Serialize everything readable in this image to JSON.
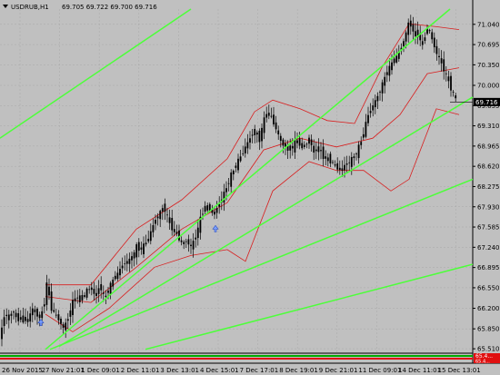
{
  "header": {
    "symbol": "USDRUB,H1",
    "ohlc": "69.705 69.722 69.700 69.716"
  },
  "colors": {
    "background": "#c0c0c0",
    "grid": "#a8a8a8",
    "candle": "#000000",
    "trendline": "#4dff3a",
    "bands": "#d81e1e",
    "current_price_bg": "#000000",
    "label_red": "#e01010",
    "label_green": "#00aa00"
  },
  "icons": {
    "arrow": "arrow-up-icon",
    "dropdown": "triangle-down-icon"
  },
  "chart_data": {
    "type": "candlestick",
    "y_ticks": [
      "71.040",
      "70.695",
      "70.350",
      "70.000",
      "69.655",
      "69.310",
      "68.965",
      "68.620",
      "68.275",
      "67.930",
      "67.585",
      "67.240",
      "66.895",
      "66.550",
      "66.200",
      "65.850",
      "65.510"
    ],
    "ylim": [
      65.45,
      71.3
    ],
    "x_ticks": [
      "26 Nov 2015",
      "27 Nov 21:01",
      "1 Dec 09:01",
      "2 Dec 11:01",
      "3 Dec 13:01",
      "4 Dec 15:01",
      "7 Dec 17:01",
      "8 Dec 19:01",
      "9 Dec 21:01",
      "11 Dec 09:01",
      "14 Dec 11:01",
      "15 Dec 13:01"
    ],
    "current_price": "69.716",
    "bottom_labels": [
      "65.4...",
      "65.4..."
    ],
    "close_path": [
      [
        0,
        65.7
      ],
      [
        5,
        66.1
      ],
      [
        10,
        66.05
      ],
      [
        15,
        66.15
      ],
      [
        20,
        66.0
      ],
      [
        25,
        66.05
      ],
      [
        30,
        65.95
      ],
      [
        35,
        66.2
      ],
      [
        40,
        66.1
      ],
      [
        45,
        66.05
      ],
      [
        50,
        66.4
      ],
      [
        52,
        66.7
      ],
      [
        55,
        66.25
      ],
      [
        60,
        66.1
      ],
      [
        65,
        66.0
      ],
      [
        70,
        65.85
      ],
      [
        75,
        66.05
      ],
      [
        80,
        66.3
      ],
      [
        85,
        66.4
      ],
      [
        90,
        66.35
      ],
      [
        95,
        66.5
      ],
      [
        100,
        66.55
      ],
      [
        105,
        66.4
      ],
      [
        110,
        66.6
      ],
      [
        115,
        66.35
      ],
      [
        120,
        66.55
      ],
      [
        125,
        66.7
      ],
      [
        130,
        66.8
      ],
      [
        135,
        66.95
      ],
      [
        140,
        67.0
      ],
      [
        145,
        67.05
      ],
      [
        150,
        67.25
      ],
      [
        155,
        67.2
      ],
      [
        160,
        67.3
      ],
      [
        165,
        67.45
      ],
      [
        170,
        67.7
      ],
      [
        175,
        67.8
      ],
      [
        180,
        67.95
      ],
      [
        185,
        67.7
      ],
      [
        190,
        67.55
      ],
      [
        195,
        67.45
      ],
      [
        200,
        67.3
      ],
      [
        205,
        67.35
      ],
      [
        210,
        67.25
      ],
      [
        215,
        67.4
      ],
      [
        220,
        67.7
      ],
      [
        225,
        67.95
      ],
      [
        230,
        67.9
      ],
      [
        235,
        67.8
      ],
      [
        240,
        67.95
      ],
      [
        245,
        68.1
      ],
      [
        250,
        68.3
      ],
      [
        255,
        68.5
      ],
      [
        260,
        68.65
      ],
      [
        265,
        68.8
      ],
      [
        270,
        68.95
      ],
      [
        275,
        69.1
      ],
      [
        280,
        69.25
      ],
      [
        285,
        69.05
      ],
      [
        290,
        69.4
      ],
      [
        295,
        69.55
      ],
      [
        300,
        69.4
      ],
      [
        305,
        69.2
      ],
      [
        310,
        69.0
      ],
      [
        315,
        68.95
      ],
      [
        320,
        68.9
      ],
      [
        325,
        69.05
      ],
      [
        330,
        69.0
      ],
      [
        335,
        68.95
      ],
      [
        340,
        69.1
      ],
      [
        345,
        68.85
      ],
      [
        350,
        68.95
      ],
      [
        355,
        68.8
      ],
      [
        360,
        68.75
      ],
      [
        365,
        68.7
      ],
      [
        370,
        68.6
      ],
      [
        375,
        68.55
      ],
      [
        380,
        68.65
      ],
      [
        385,
        68.7
      ],
      [
        390,
        68.8
      ],
      [
        395,
        68.95
      ],
      [
        400,
        69.2
      ],
      [
        405,
        69.5
      ],
      [
        410,
        69.65
      ],
      [
        415,
        69.8
      ],
      [
        420,
        70.0
      ],
      [
        425,
        70.2
      ],
      [
        430,
        70.35
      ],
      [
        435,
        70.45
      ],
      [
        440,
        70.6
      ],
      [
        445,
        70.8
      ],
      [
        450,
        71.1
      ],
      [
        455,
        70.9
      ],
      [
        460,
        70.85
      ],
      [
        465,
        70.7
      ],
      [
        470,
        71.0
      ],
      [
        475,
        70.8
      ],
      [
        480,
        70.55
      ],
      [
        485,
        70.4
      ],
      [
        490,
        70.2
      ],
      [
        495,
        70.0
      ],
      [
        500,
        69.8
      ],
      [
        503,
        69.716
      ]
    ],
    "trendlines": [
      {
        "from": [
          0,
          69.1
        ],
        "to": [
          210,
          71.3
        ]
      },
      {
        "from": [
          50,
          65.5
        ],
        "to": [
          495,
          71.3
        ]
      },
      {
        "from": [
          65,
          65.55
        ],
        "to": [
          520,
          69.8
        ]
      },
      {
        "from": [
          55,
          65.5
        ],
        "to": [
          520,
          68.4
        ]
      },
      {
        "from": [
          160,
          65.5
        ],
        "to": [
          520,
          66.95
        ]
      }
    ],
    "band_upper": [
      [
        50,
        66.6
      ],
      [
        100,
        66.6
      ],
      [
        150,
        67.55
      ],
      [
        200,
        68.05
      ],
      [
        250,
        68.75
      ],
      [
        280,
        69.55
      ],
      [
        300,
        69.75
      ],
      [
        330,
        69.6
      ],
      [
        360,
        69.4
      ],
      [
        390,
        69.35
      ],
      [
        420,
        70.3
      ],
      [
        450,
        71.05
      ],
      [
        480,
        71.0
      ],
      [
        505,
        70.95
      ]
    ],
    "band_lower": [
      [
        50,
        66.1
      ],
      [
        80,
        65.8
      ],
      [
        120,
        66.2
      ],
      [
        170,
        66.9
      ],
      [
        210,
        67.1
      ],
      [
        250,
        67.2
      ],
      [
        270,
        67.0
      ],
      [
        300,
        68.2
      ],
      [
        340,
        68.7
      ],
      [
        370,
        68.55
      ],
      [
        400,
        68.55
      ],
      [
        430,
        68.2
      ],
      [
        450,
        68.4
      ],
      [
        480,
        69.6
      ],
      [
        505,
        69.5
      ]
    ],
    "band_mid": [
      [
        50,
        66.4
      ],
      [
        100,
        66.3
      ],
      [
        150,
        66.9
      ],
      [
        200,
        67.55
      ],
      [
        250,
        68.0
      ],
      [
        290,
        68.9
      ],
      [
        330,
        69.1
      ],
      [
        370,
        68.95
      ],
      [
        410,
        69.1
      ],
      [
        440,
        69.5
      ],
      [
        470,
        70.2
      ],
      [
        505,
        70.3
      ]
    ],
    "arrows": [
      {
        "x": 45,
        "y": 65.95
      },
      {
        "x": 237,
        "y": 67.55
      }
    ]
  }
}
